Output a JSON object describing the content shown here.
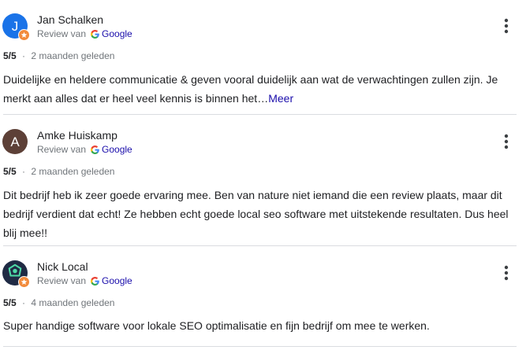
{
  "reviews": [
    {
      "name": "Jan Schalken",
      "avatar_letter": "J",
      "avatar_color": "#1a73e8",
      "review_via_label": "Review van",
      "source": "Google",
      "rating": "5/5",
      "separator": "·",
      "time": "2 maanden geleden",
      "text": "Duidelijke en heldere communicatie & geven vooral duidelijk aan wat de verwachtingen zullen zijn. Je merkt aan alles dat er heel veel kennis is binnen het…",
      "more_label": "Meer"
    },
    {
      "name": "Amke Huiskamp",
      "avatar_letter": "A",
      "avatar_color": "#5d4037",
      "review_via_label": "Review van",
      "source": "Google",
      "rating": "5/5",
      "separator": "·",
      "time": "2 maanden geleden",
      "text": "Dit bedrijf heb ik zeer goede ervaring mee. Ben van nature niet iemand die een review plaats, maar dit bedrijf verdient dat echt! Ze hebben echt goede local seo software met uitstekende resultaten. Dus heel blij mee!!"
    },
    {
      "name": "Nick Local",
      "avatar_color": "#1f2a44",
      "avatar_icon": "map-pin-logo-icon",
      "review_via_label": "Review van",
      "source": "Google",
      "rating": "5/5",
      "separator": "·",
      "time": "4 maanden geleden",
      "text": "Super handige software voor lokale SEO optimalisatie en fijn bedrijf om mee te werken."
    }
  ],
  "icons": {
    "more_options": "more-vert-icon",
    "badge": "local-guide-star-icon",
    "source_logo": "google-g-icon"
  },
  "colors": {
    "link": "#1a0dab",
    "badge": "#f28b3c",
    "divider": "#dadce0",
    "secondary_text": "#70757a"
  }
}
